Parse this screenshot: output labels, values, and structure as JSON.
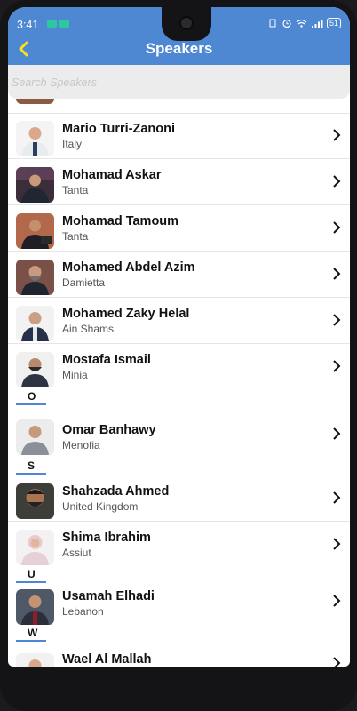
{
  "status_bar": {
    "time": "3:41",
    "battery": "51"
  },
  "header": {
    "title": "Speakers"
  },
  "search": {
    "placeholder": "Search Speakers"
  },
  "speakers": [
    {
      "name": "Mario Turri-Zanoni",
      "location": "Italy"
    },
    {
      "name": "Mohamad Askar",
      "location": "Tanta"
    },
    {
      "name": "Mohamad Tamoum",
      "location": "Tanta"
    },
    {
      "name": "Mohamed Abdel Azim",
      "location": "Damietta"
    },
    {
      "name": "Mohamed Zaky Helal",
      "location": "Ain Shams"
    },
    {
      "name": "Mostafa Ismail",
      "location": "Minia"
    },
    {
      "name": "Omar Banhawy",
      "location": "Menofia"
    },
    {
      "name": "Shahzada Ahmed",
      "location": "United Kingdom"
    },
    {
      "name": "Shima Ibrahim",
      "location": "Assiut"
    },
    {
      "name": "Usamah Elhadi",
      "location": "Lebanon"
    },
    {
      "name": "Wael Al Mallah",
      "location": ""
    }
  ],
  "section_letters": {
    "o": "O",
    "s": "S",
    "u": "U",
    "w": "W"
  },
  "colors": {
    "app_bar": "#4f88d2",
    "back_chevron": "#f5e31a",
    "section_underline": "#4f88d2"
  },
  "icons": {
    "back": "chevron-left-icon",
    "row": "chevron-right-icon"
  }
}
